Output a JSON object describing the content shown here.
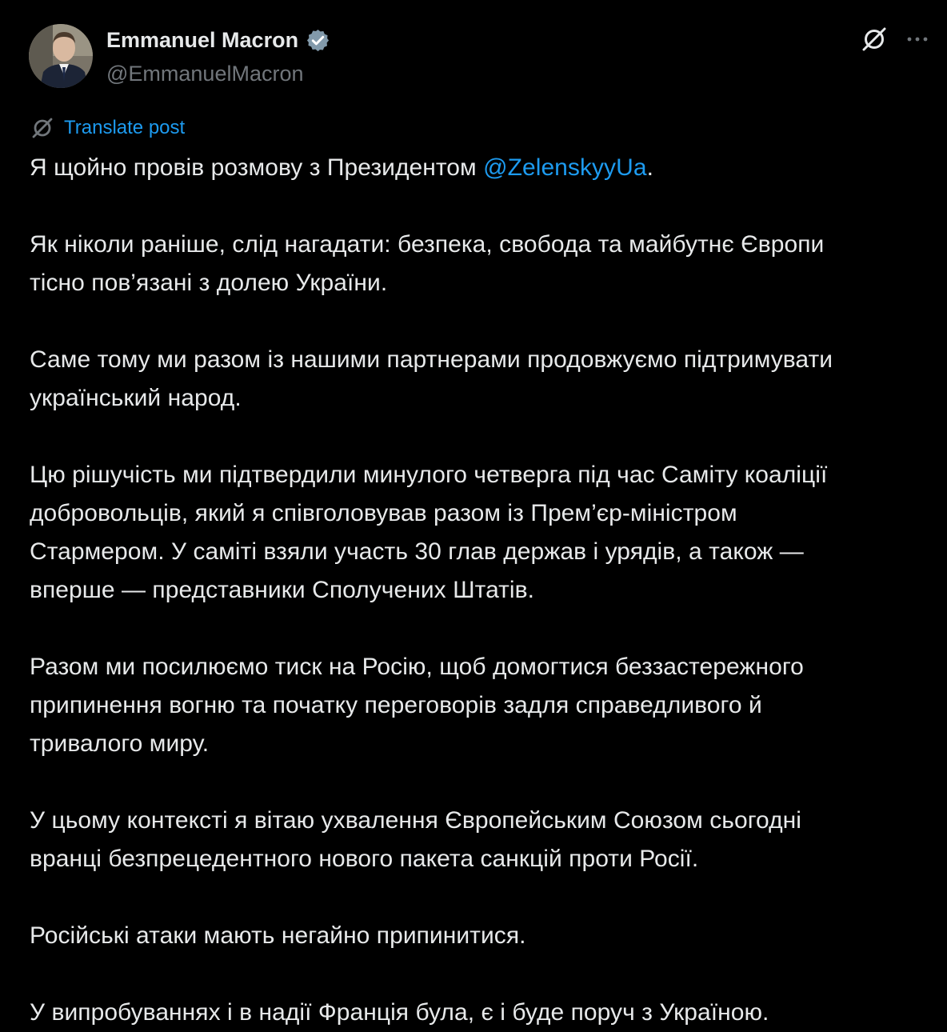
{
  "author": {
    "display_name": "Emmanuel Macron",
    "handle": "@EmmanuelMacron",
    "verified_icon": "verified-badge-icon",
    "avatar": "profile-photo"
  },
  "actions": {
    "grok_icon": "grok-icon",
    "more_icon": "more-options-icon"
  },
  "translate": {
    "label": "Translate post",
    "icon": "grok-translate-icon"
  },
  "post": {
    "p1": {
      "text": "Я щойно провів розмову з Президентом ",
      "mention": "@ZelenskyyUa",
      "end": "."
    },
    "p2": {
      "line1": "Як ніколи раніше, слід нагадати: безпека, свобода та майбутнє Європи",
      "line2": "тісно пов’язані з долею України."
    },
    "p3": {
      "line1": "Саме тому ми разом із нашими партнерами продовжуємо підтримувати",
      "line2": "український народ."
    },
    "p4": {
      "line1": "Цю рішучість ми підтвердили минулого четверга під час Саміту коаліції",
      "line2": "добровольців, який я співголовував разом із Прем’єр-міністром",
      "line3": "Стармером. У саміті взяли участь 30 глав держав і урядів, а також —",
      "line4": "вперше — представники Сполучених Штатів."
    },
    "p5": {
      "line1": "Разом ми посилюємо тиск на Росію, щоб домогтися беззастережного",
      "line2": "припинення вогню та початку переговорів задля справедливого й",
      "line3": "тривалого миру."
    },
    "p6": {
      "line1": "У цьому контексті я вітаю ухвалення Європейським Союзом сьогодні",
      "line2": "вранці безпрецедентного нового пакета санкцій проти Росії."
    },
    "p7": {
      "line1": "Російські атаки мають негайно припинитися."
    },
    "p8": {
      "line1": "У випробуваннях і в надії Франція була, є і буде поруч з Україною."
    }
  },
  "colors": {
    "background": "#000000",
    "text": "#e7e9ea",
    "secondary": "#71767b",
    "link": "#1d9bf0",
    "verified": "#829aab"
  }
}
